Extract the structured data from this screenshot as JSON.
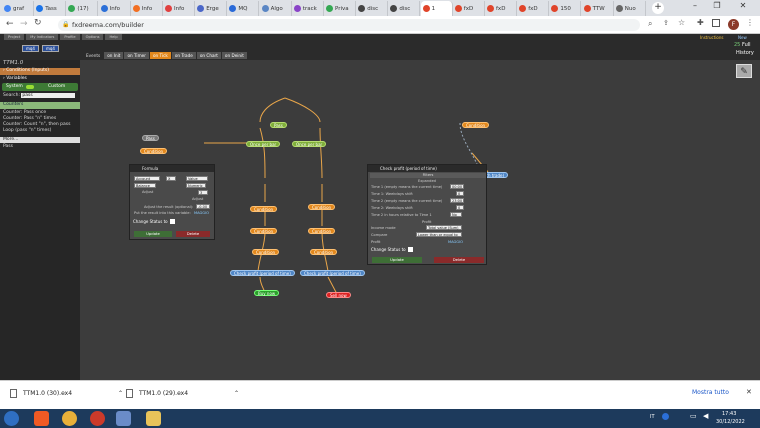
{
  "browser": {
    "tabs": [
      {
        "label": "graf"
      },
      {
        "label": "Tass"
      },
      {
        "label": "(17)"
      },
      {
        "label": "Info"
      },
      {
        "label": "Info"
      },
      {
        "label": "Info"
      },
      {
        "label": "Erge"
      },
      {
        "label": "MQ"
      },
      {
        "label": "Algo"
      },
      {
        "label": "track"
      },
      {
        "label": "Priva"
      },
      {
        "label": "disc"
      },
      {
        "label": "disc"
      },
      {
        "label": "1"
      },
      {
        "label": "fxD"
      },
      {
        "label": "fxD"
      },
      {
        "label": "fxD"
      },
      {
        "label": "150"
      },
      {
        "label": "TTW"
      },
      {
        "label": "Nuo"
      }
    ],
    "url": "fxdreema.com/builder",
    "profile_initial": "F"
  },
  "app": {
    "top_buttons": [
      "Project",
      "My Indicators",
      "Profile",
      "Options",
      "Help"
    ],
    "mql_badges": [
      "mq4",
      "mq4"
    ],
    "instructions_link": "Instructions",
    "new_link": "New",
    "full_label": "Full",
    "history_label": "History",
    "zoom_level": "25",
    "tabs": [
      "Events",
      "on Init",
      "on Timer",
      "on Tick",
      "on Trade",
      "on Chart",
      "on Deinit"
    ],
    "project_name": "TTM1.0",
    "left_panel": {
      "section_title": "Conditions (Inputs)",
      "variables_label": "Variables",
      "system_label": "System",
      "custom_label": "Custom",
      "search_label": "Search:",
      "search_value": "pass",
      "counters_header": "Counters",
      "counters_items": [
        "Counter: Pass once",
        "Counter: Pass \"n\" times",
        "Counter: Count \"n\", then pass",
        "Loop (pass \"n\" times)"
      ],
      "more_label": "More...",
      "pass_label": "Pass"
    },
    "nodes": {
      "pass_top": "Pass",
      "condition_left": "Condition",
      "pass_mid": "Pass",
      "once_per_bar_1": "Once per bar",
      "once_per_bar_2": "Once per bar",
      "cond_a1": "Condition",
      "cond_a2": "Condition",
      "cond_a3": "Condition",
      "cond_b1": "Condition",
      "cond_b2": "Condition",
      "cond_b3": "Condition",
      "check_profit_1": "Check profit (period of time)",
      "check_profit_2": "Check profit (period of time)",
      "buy_now": "Buy now",
      "sell_now": "Sell now",
      "condition_right": "Condition",
      "break_even": "Break even point (each trade)"
    },
    "formula_dialog": {
      "title": "Formula",
      "left_dropdown": "Account",
      "left_sub": "Balance",
      "operator": "X",
      "right_dropdown": "Value",
      "right_sub": "Numeric",
      "adjust_label": "Adjust",
      "right_value": "3",
      "adjust_result_label": "Adjust the result (optional):",
      "adjust_result_value": "-0.00",
      "variable_label": "Put the result into this variable:",
      "variable_value": "MAGGIO",
      "change_status_label": "Change Status to",
      "update_button": "Update",
      "delete_button": "Delete"
    },
    "check_profit_dialog": {
      "title": "Check profit (period of time)",
      "subheader": "Filters",
      "group_label": "Expanded",
      "time1_label": "Time 1 (empty means the current time)",
      "time1_value": "00:00",
      "time1_shift_label": "Time 1: Weekdays shift",
      "time1_shift_value": "0",
      "time2_label": "Time 2 (empty means the current time)",
      "time2_value": "23:00",
      "time2_shift_label": "Time 2: Weekdays shift",
      "time2_shift_value": "0",
      "time2_hours_label": "Time 2 in hours relative to Time 1",
      "time2_hours_value": "No",
      "profit_section": "Profit",
      "income_label": "Income mode",
      "income_value": "Total value (Sum)",
      "compare_label": "Compare",
      "compare_value": "Lower than or equal to",
      "profit_label": "Profit",
      "profit_value": "MAGGIO",
      "change_status_label": "Change Status to",
      "update_button": "Update",
      "delete_button": "Delete"
    }
  },
  "downloads": {
    "items": [
      "TTM1.0 (30).ex4",
      "TTM1.0 (29).ex4"
    ],
    "show_all": "Mostra tutto"
  },
  "taskbar": {
    "lang": "IT",
    "time": "17:43",
    "date": "30/12/2022"
  },
  "colors": {
    "node_green": "#7fae3a",
    "node_orange": "#e2881d",
    "node_blue": "#4f86c6",
    "node_red": "#dd2222",
    "tab_active": "#e2881d"
  }
}
